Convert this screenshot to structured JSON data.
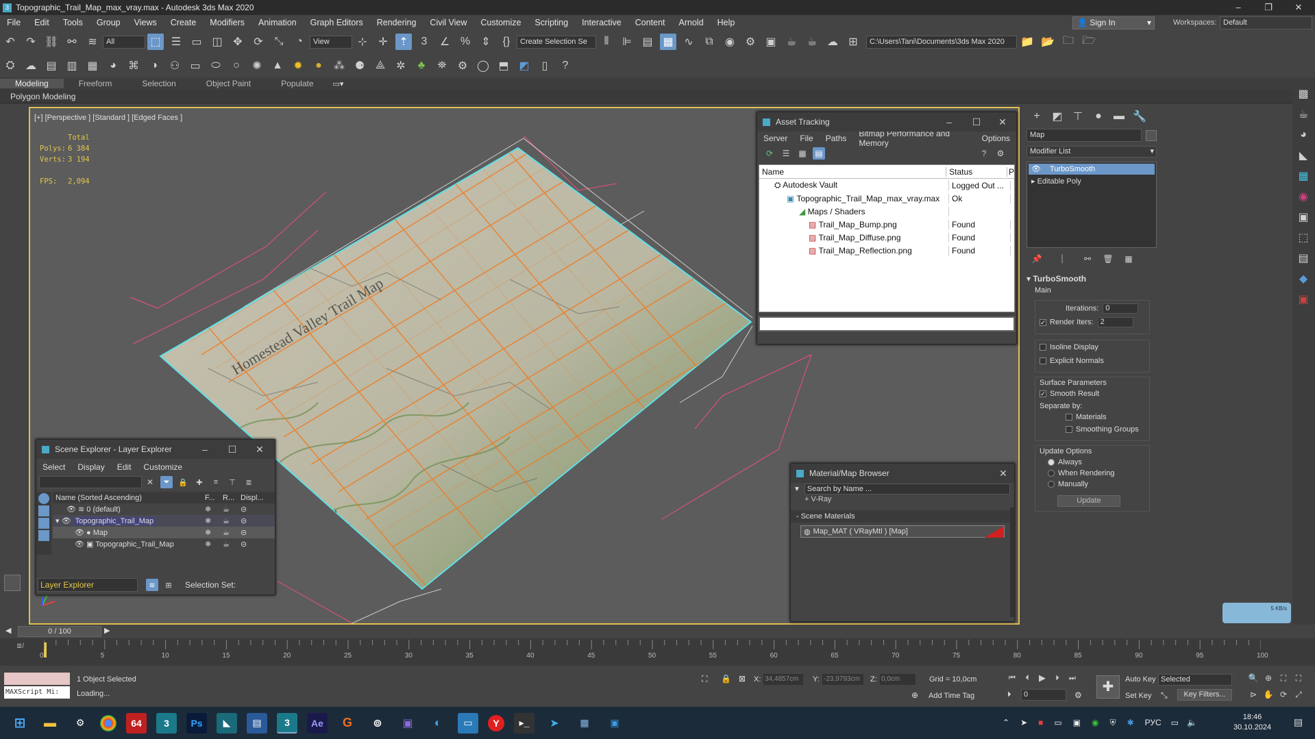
{
  "window": {
    "title": "Topographic_Trail_Map_max_vray.max - Autodesk 3ds Max 2020",
    "minimize": "–",
    "maximize": "❐",
    "close": "✕"
  },
  "menu": [
    "File",
    "Edit",
    "Tools",
    "Group",
    "Views",
    "Create",
    "Modifiers",
    "Animation",
    "Graph Editors",
    "Rendering",
    "Civil View",
    "Customize",
    "Scripting",
    "Interactive",
    "Content",
    "Arnold",
    "Help"
  ],
  "account": {
    "signin": "Sign In",
    "workspaces_label": "Workspaces:",
    "workspace": "Default"
  },
  "toolbar": {
    "filter": "All",
    "refcoord": "View",
    "named_selection": "Create Selection Se",
    "project_path": "C:\\Users\\Tani\\Documents\\3ds Max 2020"
  },
  "ribbon": {
    "tabs": [
      "Modeling",
      "Freeform",
      "Selection",
      "Object Paint",
      "Populate"
    ],
    "active": "Modeling",
    "panel": "Polygon Modeling"
  },
  "viewport": {
    "label": "[+] [Perspective ] [Standard ] [Edged Faces ]",
    "stats": {
      "total_label": "Total",
      "polys_label": "Polys:",
      "polys": "6 384",
      "verts_label": "Verts:",
      "verts": "3 194",
      "fps_label": "FPS:",
      "fps": "2,094"
    },
    "map_text": "Homestead Valley Trail Map"
  },
  "asset_tracking": {
    "title": "Asset Tracking",
    "menu": [
      "Server",
      "File",
      "Paths",
      "Bitmap Performance and Memory",
      "Options"
    ],
    "columns": [
      "Name",
      "Status",
      "P"
    ],
    "rows": [
      {
        "name": "Autodesk Vault",
        "status": "Logged Out ..."
      },
      {
        "name": "Topographic_Trail_Map_max_vray.max",
        "status": "Ok"
      },
      {
        "name": "Maps / Shaders",
        "status": ""
      },
      {
        "name": "Trail_Map_Bump.png",
        "status": "Found"
      },
      {
        "name": "Trail_Map_Diffuse.png",
        "status": "Found"
      },
      {
        "name": "Trail_Map_Reflection.png",
        "status": "Found"
      }
    ]
  },
  "scene_explorer": {
    "title": "Scene Explorer - Layer Explorer",
    "menu": [
      "Select",
      "Display",
      "Edit",
      "Customize"
    ],
    "columns": [
      "Name (Sorted Ascending)",
      "F...",
      "R...",
      "Displ..."
    ],
    "rows": [
      "0 (default)",
      "Topographic_Trail_Map",
      "Map",
      "Topographic_Trail_Map"
    ],
    "footer_mode": "Layer Explorer",
    "selection_set_label": "Selection Set:"
  },
  "material_browser": {
    "title": "Material/Map Browser",
    "search_placeholder": "Search by Name ...",
    "group_vray": "+ V-Ray",
    "group_scene": "- Scene Materials",
    "material": "Map_MAT ( VRayMtl ) [Map]"
  },
  "command_panel": {
    "object_name": "Map",
    "modifier_list": "Modifier List",
    "stack": [
      "TurboSmooth",
      "Editable Poly"
    ],
    "rollout_title": "TurboSmooth",
    "main_label": "Main",
    "iterations_label": "Iterations:",
    "iterations": "0",
    "render_iters_label": "Render Iters:",
    "render_iters": "2",
    "isoline": "Isoline Display",
    "explicit_normals": "Explicit Normals",
    "surface_params": "Surface Parameters",
    "smooth_result": "Smooth Result",
    "separate_by": "Separate by:",
    "materials": "Materials",
    "smoothing_groups": "Smoothing Groups",
    "update_options": "Update Options",
    "always": "Always",
    "when_rendering": "When Rendering",
    "manually": "Manually",
    "update_btn": "Update"
  },
  "net_widget": {
    "speed": "5 KB/s"
  },
  "timeline": {
    "frame": "0 / 100",
    "ticks": [
      "0",
      "5",
      "10",
      "15",
      "20",
      "25",
      "30",
      "35",
      "40",
      "45",
      "50",
      "55",
      "60",
      "65",
      "70",
      "75",
      "80",
      "85",
      "90",
      "95",
      "100"
    ]
  },
  "status": {
    "maxscript": "MAXScript Mi:",
    "selected": "1 Object Selected",
    "loading": "Loading...",
    "x_label": "X:",
    "x": "34,4857cm",
    "y_label": "Y:",
    "y": "-23,9793cm",
    "z_label": "Z:",
    "z": "0,0cm",
    "grid": "Grid = 10,0cm",
    "add_time_tag": "Add Time Tag",
    "auto_key": "Auto Key",
    "set_key": "Set Key",
    "key_mode": "Selected",
    "key_filters": "Key Filters...",
    "current_frame": "0"
  },
  "taskbar": {
    "lang": "РУС",
    "time": "18:46",
    "date": "30.10.2024"
  },
  "colors": {
    "accent": "#6b97c9",
    "viewport_border": "#e0c050",
    "select_outline": "#5fe0e8",
    "grid_orange": "#f07a20",
    "gizmo": "#ff4f7f"
  }
}
